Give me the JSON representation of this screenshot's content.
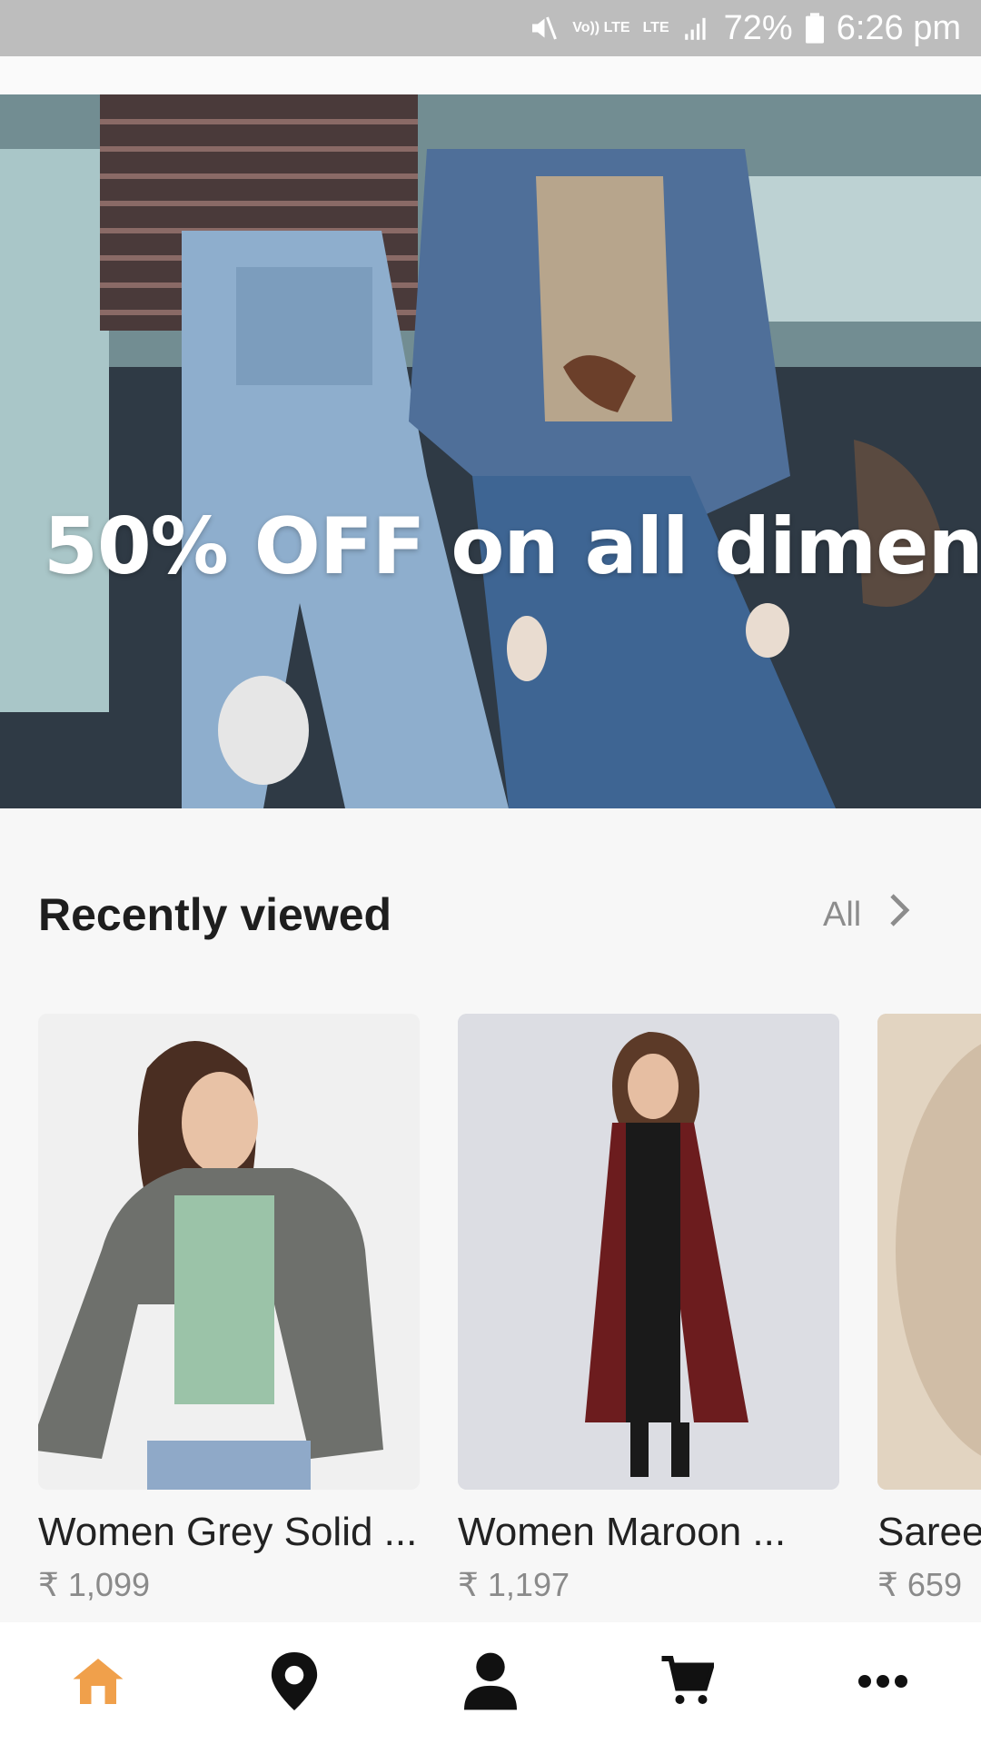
{
  "status_bar": {
    "volte_label": "Vo)) LTE",
    "lte_label": "LTE",
    "battery_percent": "72%",
    "time": "6:26 pm"
  },
  "banner": {
    "headline": "50% OFF on all dimen",
    "slide_count": 4,
    "active_slide": 4
  },
  "recently_viewed": {
    "title": "Recently viewed",
    "see_all_label": "All",
    "products": [
      {
        "name": "Women Grey Solid ...",
        "price": "₹ 1,099"
      },
      {
        "name": "Women Maroon ...",
        "price": "₹ 1,197"
      },
      {
        "name": "Saree",
        "price": "₹ 659"
      }
    ]
  },
  "bottom_nav": {
    "items": [
      "home-icon",
      "location-icon",
      "profile-icon",
      "cart-icon",
      "more-icon"
    ],
    "active_color": "#f0a04b",
    "inactive_color": "#111111"
  }
}
